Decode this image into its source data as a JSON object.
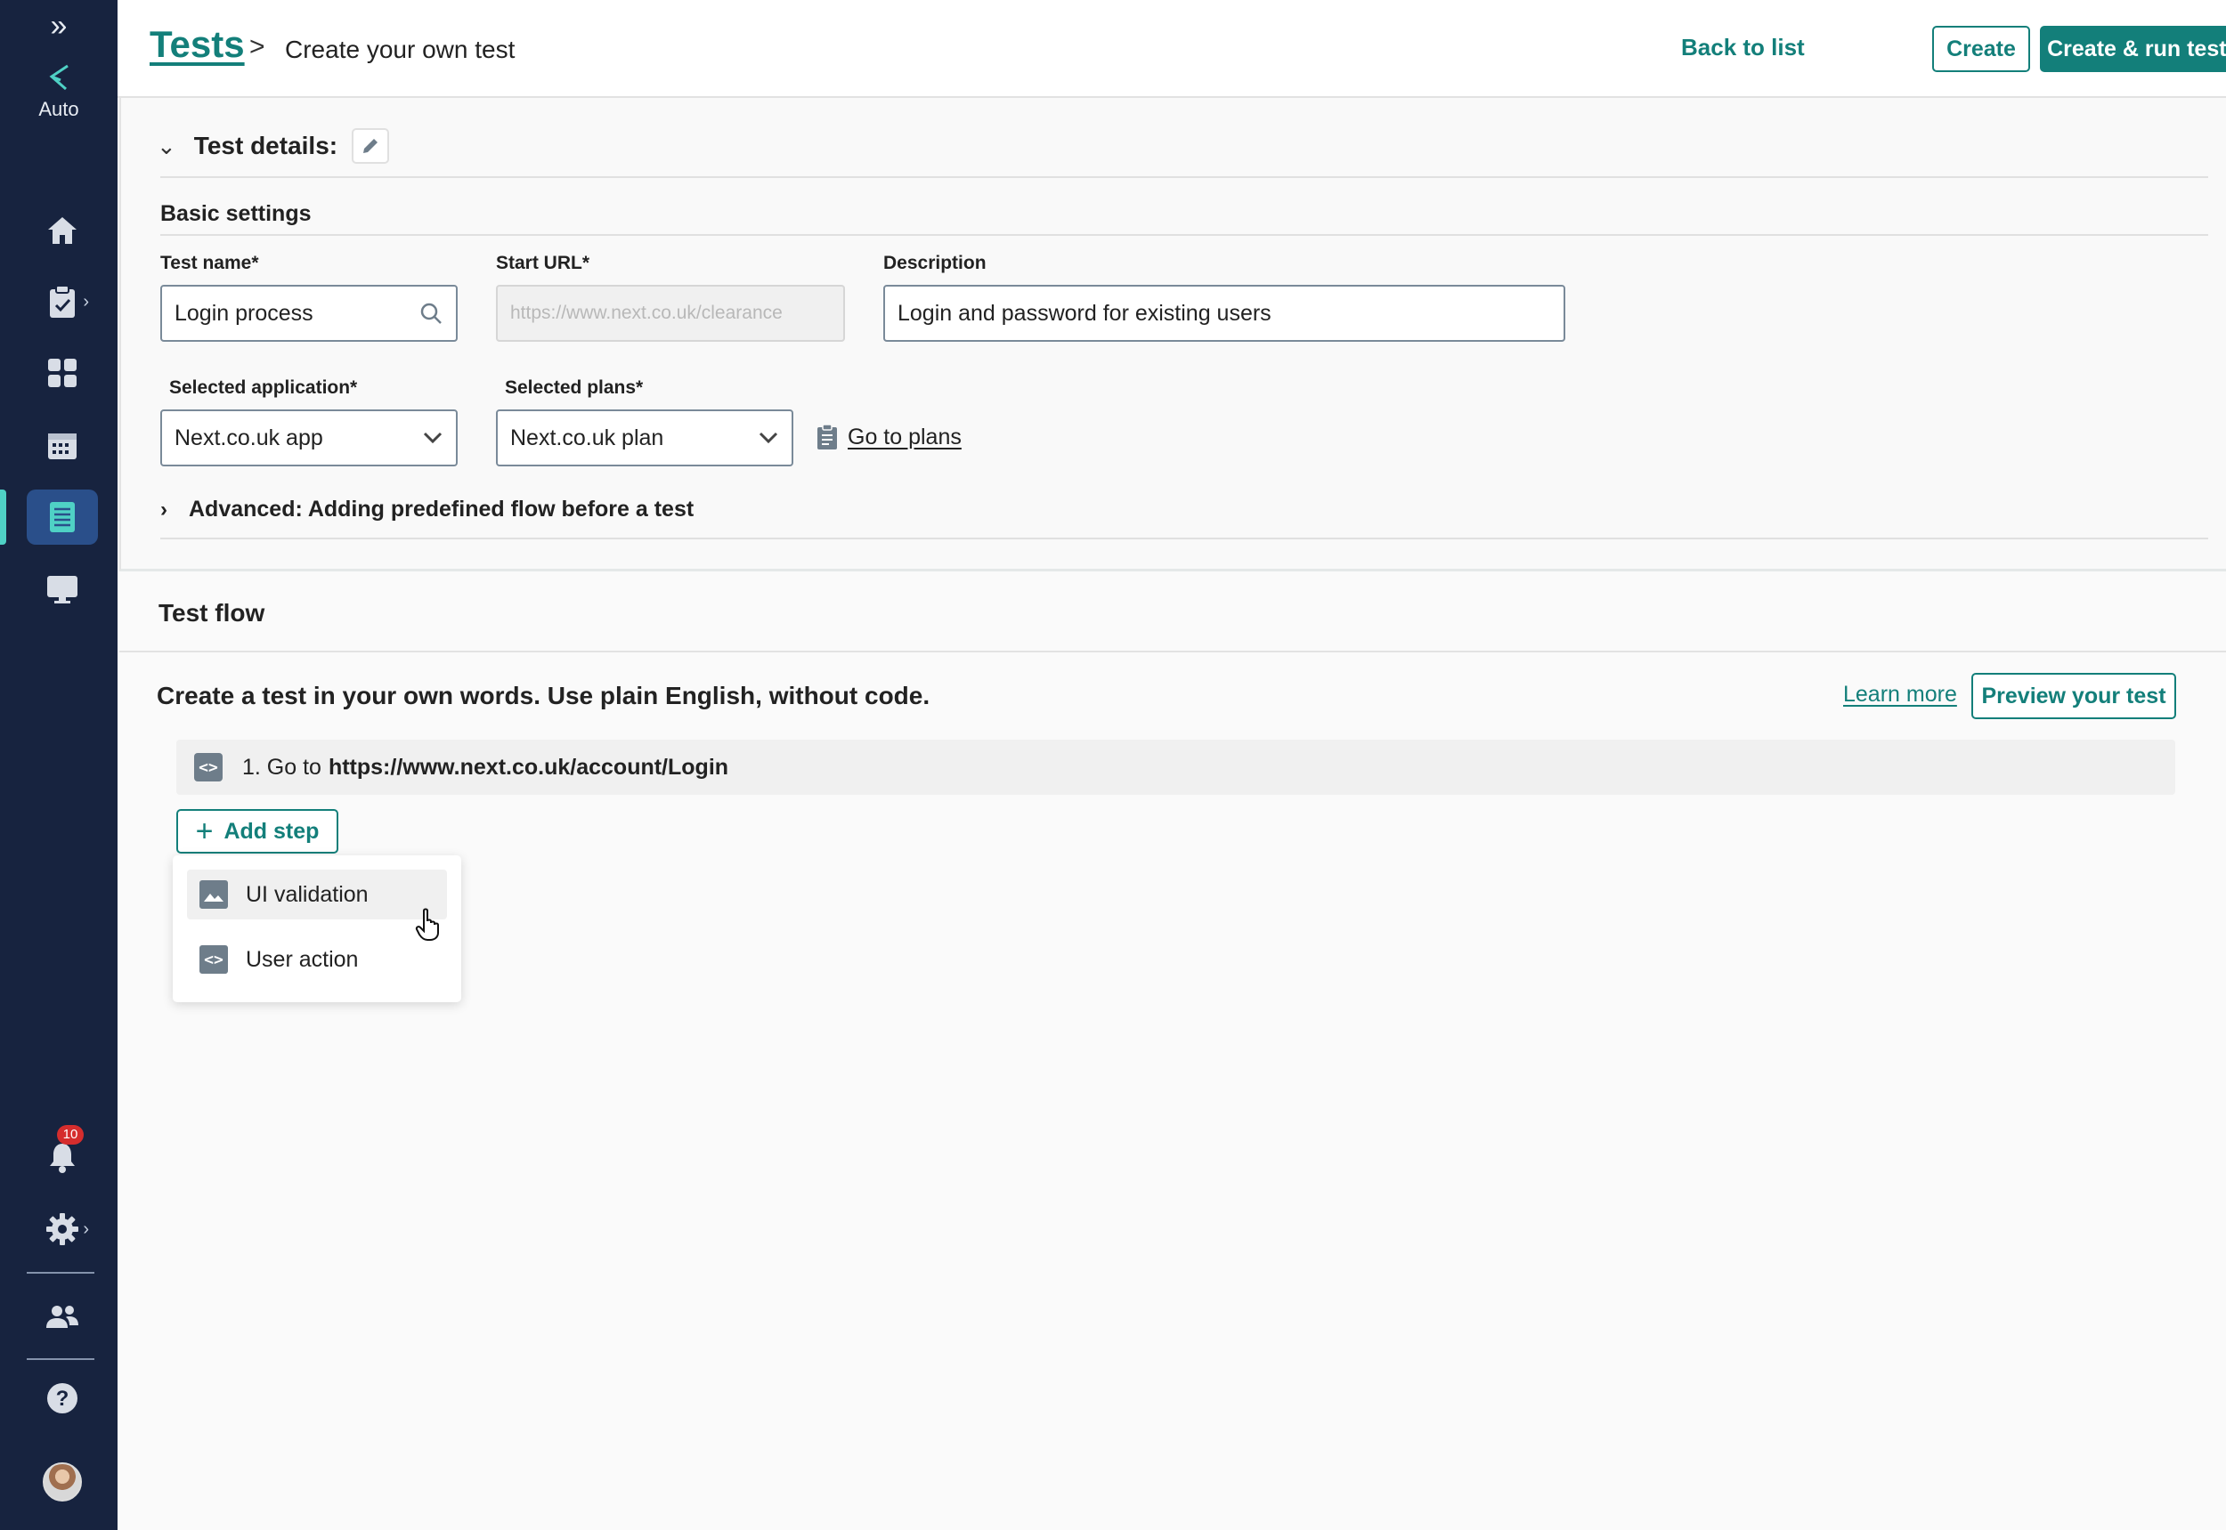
{
  "sidebar": {
    "logo_label": "Auto",
    "icons": [
      "expand-icon",
      "home-icon",
      "clipboard-icon",
      "dashboard-icon",
      "calendar-icon",
      "list-icon",
      "monitor-icon",
      "bell-icon",
      "gear-icon",
      "users-icon",
      "help-icon"
    ],
    "notifications_count": "10",
    "active_item": "list-icon"
  },
  "header": {
    "breadcrumb_root": "Tests",
    "breadcrumb_separator": ">",
    "breadcrumb_current": "Create your own test",
    "back_to_list": "Back to list",
    "create": "Create",
    "create_run": "Create & run test plan"
  },
  "details": {
    "title": "Test details:",
    "basic_settings": "Basic settings",
    "test_name_label": "Test name*",
    "test_name_value": "Login process",
    "start_url_label": "Start URL*",
    "start_url_placeholder": "https://www.next.co.uk/clearance",
    "description_label": "Description",
    "description_value": "Login and password for existing users",
    "selected_application_label": "Selected application*",
    "selected_application_value": "Next.co.uk app",
    "selected_plans_label": "Selected plans*",
    "selected_plans_value": "Next.co.uk plan",
    "go_to_plans": "Go to plans",
    "advanced": "Advanced: Adding predefined flow before a test"
  },
  "flow": {
    "title": "Test flow",
    "subtitle": "Create a test in your own words. Use plain English, without code.",
    "learn_more": "Learn more",
    "preview": "Preview your test",
    "steps": [
      {
        "number_prefix": "1. Go to",
        "url": "https://www.next.co.uk/account/Login"
      }
    ],
    "add_step": "Add step",
    "menu": [
      {
        "label": "UI validation",
        "icon": "image-icon"
      },
      {
        "label": "User action",
        "icon": "code-icon"
      }
    ]
  },
  "colors": {
    "sidebar_bg": "#17233f",
    "accent": "#137f7a",
    "active_indicator": "#4fd1c5",
    "badge": "#d52d2d"
  }
}
